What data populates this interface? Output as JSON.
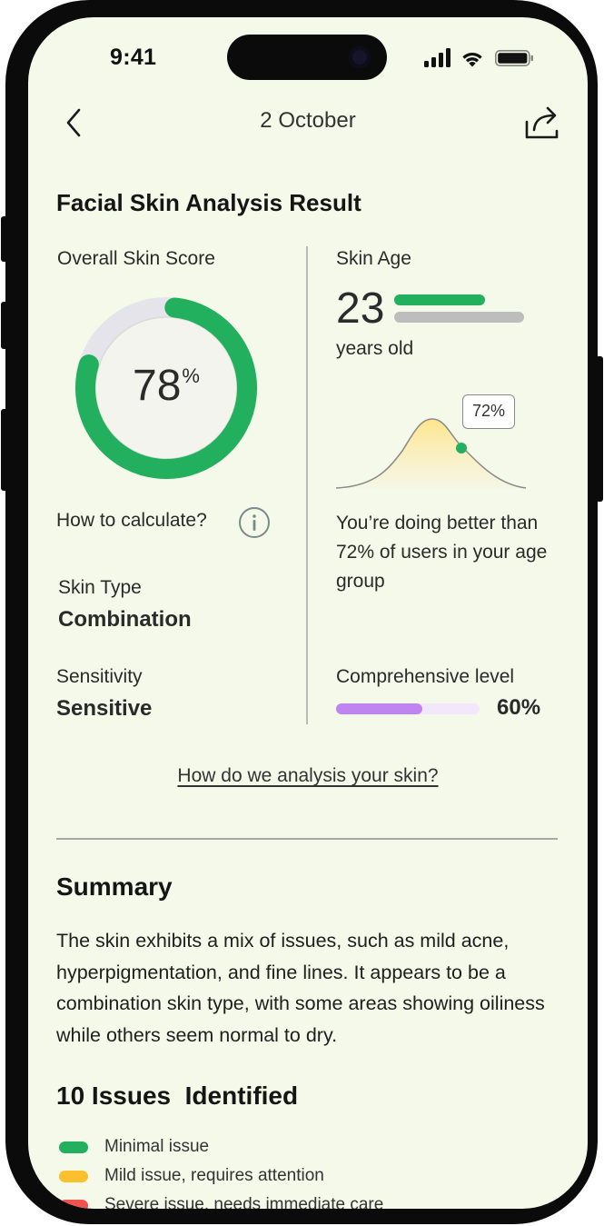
{
  "status_bar": {
    "time": "9:41"
  },
  "nav": {
    "title": "2 October"
  },
  "heading": "Facial Skin Analysis Result",
  "overall": {
    "label": "Overall Skin Score",
    "score": 78,
    "score_text": "78",
    "unit": "%",
    "how_label": "How to calculate?"
  },
  "skin_type": {
    "label": "Skin Type",
    "value": "Combination"
  },
  "sensitivity": {
    "label": "Sensitivity",
    "value": "Sensitive"
  },
  "skin_age": {
    "label": "Skin Age",
    "age": "23",
    "unit": "years old",
    "bar_fraction": 0.7,
    "percentile_tooltip": "72%",
    "percentile": 72,
    "comparison_text": "You’re doing better than 72% of users in your age group"
  },
  "comprehensive": {
    "label": "Comprehensive level",
    "value_text": "60%",
    "fraction": 0.6
  },
  "analysis_link": "How do we analysis your skin?",
  "summary": {
    "title": "Summary",
    "text": "The skin exhibits a mix of issues, such as mild acne, hyperpigmentation, and fine lines. It appears to be a combination skin type, with some areas showing oiliness while others seem normal to dry."
  },
  "issues": {
    "title": "10 Issues  Identified",
    "legend": [
      {
        "label": "Minimal issue",
        "color": "#22b05e"
      },
      {
        "label": "Mild issue, requires attention",
        "color": "#fbc02d"
      },
      {
        "label": "Severe issue, needs immediate care",
        "color": "#ef5350"
      }
    ]
  },
  "colors": {
    "accent_green": "#22b05e",
    "purple": "#c084f0",
    "background": "#f5f9ea"
  }
}
